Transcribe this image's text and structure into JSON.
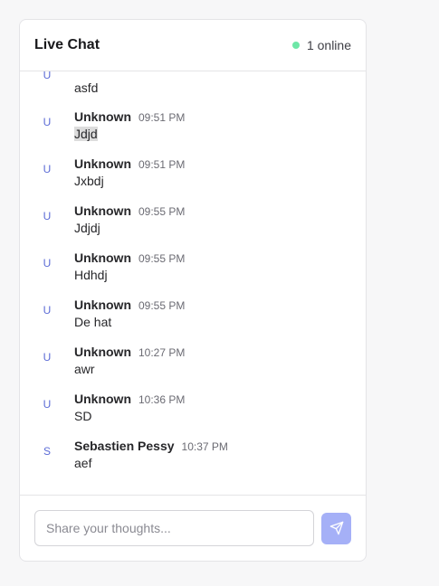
{
  "header": {
    "title": "Live Chat",
    "online_text": "1 online"
  },
  "messages": [
    {
      "initial": "U",
      "author": "",
      "time": "",
      "text": "asfd"
    },
    {
      "initial": "U",
      "author": "Unknown",
      "time": "09:51 PM",
      "text": "Jdjd"
    },
    {
      "initial": "U",
      "author": "Unknown",
      "time": "09:51 PM",
      "text": "Jxbdj"
    },
    {
      "initial": "U",
      "author": "Unknown",
      "time": "09:55 PM",
      "text": "Jdjdj"
    },
    {
      "initial": "U",
      "author": "Unknown",
      "time": "09:55 PM",
      "text": "Hdhdj"
    },
    {
      "initial": "U",
      "author": "Unknown",
      "time": "09:55 PM",
      "text": "De hat"
    },
    {
      "initial": "U",
      "author": "Unknown",
      "time": "10:27 PM",
      "text": "awr"
    },
    {
      "initial": "U",
      "author": "Unknown",
      "time": "10:36 PM",
      "text": "SD"
    },
    {
      "initial": "S",
      "author": "Sebastien Pessy",
      "time": "10:37 PM",
      "text": "aef"
    }
  ],
  "composer": {
    "placeholder": "Share your thoughts...",
    "send_icon": "paper-plane-icon"
  },
  "colors": {
    "online_dot": "#6ee7a7",
    "avatar_initial": "#5b6bd6",
    "send_button": "#a5b0f7"
  }
}
